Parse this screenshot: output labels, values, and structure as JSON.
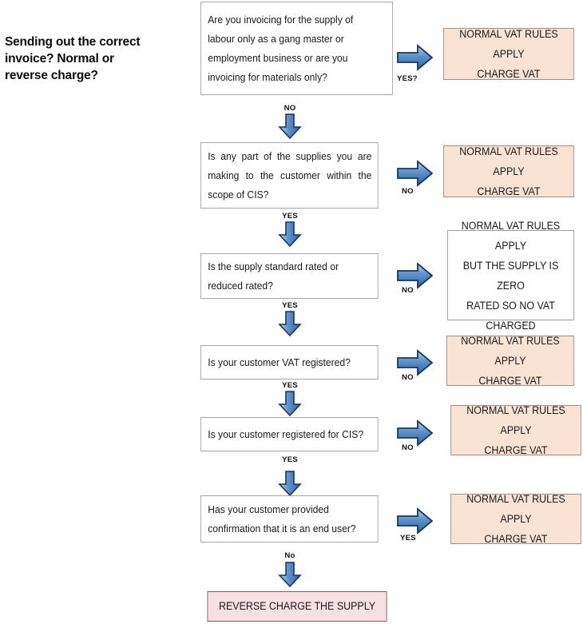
{
  "title": {
    "line1": "Sending out the correct",
    "line2": "invoice? Normal or",
    "line3": "reverse charge?"
  },
  "colors": {
    "outcome_fill": "#fbe3d4",
    "outcome_border": "#9c8f88",
    "white_fill": "#ffffff",
    "pink_fill": "#f7dfe3",
    "pink_border": "#8a5a5f",
    "arrow_blue_light": "#8fb4dd",
    "arrow_blue_dark": "#2f6cb0",
    "arrow_outline": "#17365d",
    "question_border": "#a6a6a6"
  },
  "questions": [
    {
      "id": "q1",
      "lines": [
        "Are you invoicing for the supply of",
        "labour only as a gang master or",
        "employment business or are you",
        "invoicing for materials only?"
      ]
    },
    {
      "id": "q2",
      "lines": [
        "Is any part of the supplies you are",
        "making to the customer within the",
        "scope of CIS?"
      ]
    },
    {
      "id": "q3",
      "lines": [
        "Is the supply standard rated or",
        "reduced rated?"
      ]
    },
    {
      "id": "q4",
      "lines": [
        "Is your customer VAT registered?"
      ]
    },
    {
      "id": "q5",
      "lines": [
        "Is your customer registered for CIS?"
      ]
    },
    {
      "id": "q6",
      "lines": [
        "Has your customer provided",
        "confirmation that it is an end user?"
      ]
    }
  ],
  "outcomes": [
    {
      "id": "o1",
      "lines": [
        "NORMAL VAT RULES APPLY",
        "CHARGE VAT"
      ]
    },
    {
      "id": "o2",
      "lines": [
        "NORMAL VAT RULES APPLY",
        "CHARGE VAT"
      ]
    },
    {
      "id": "o3",
      "lines": [
        "NORMAL VAT RULES APPLY",
        "BUT THE SUPPLY IS ZERO",
        "RATED SO NO VAT",
        "CHARGED"
      ]
    },
    {
      "id": "o4",
      "lines": [
        "NORMAL VAT RULES APPLY",
        "CHARGE VAT"
      ]
    },
    {
      "id": "o5",
      "lines": [
        "NORMAL VAT RULES APPLY",
        "CHARGE VAT"
      ]
    },
    {
      "id": "o6",
      "lines": [
        "NORMAL VAT RULES APPLY",
        "CHARGE VAT"
      ]
    }
  ],
  "final": {
    "label": "REVERSE CHARGE THE SUPPLY"
  },
  "branch_labels": {
    "right1": "YES?",
    "right2": "NO",
    "right3": "NO",
    "right4": "NO",
    "right5": "NO",
    "right6": "YES",
    "down1": "NO",
    "down2": "YES",
    "down3": "YES",
    "down4": "YES",
    "down5": "YES",
    "down6": "No"
  }
}
